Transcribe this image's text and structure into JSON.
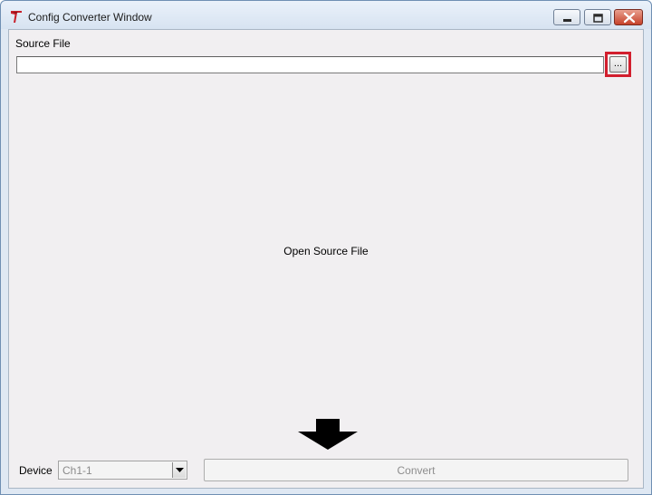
{
  "window": {
    "title": "Config Converter Window",
    "icon": "app-logo-icon",
    "controls": [
      "minimize-icon",
      "maximize-icon",
      "close-icon"
    ]
  },
  "source": {
    "label": "Source File",
    "path_value": "",
    "browse_label": "...",
    "highlight_color": "#d21f2e"
  },
  "main": {
    "message": "Open Source File",
    "arrow_icon": "arrow-down-icon"
  },
  "footer": {
    "device_label": "Device",
    "device_selected": "Ch1-1",
    "convert_label": "Convert"
  },
  "colors": {
    "client_bg": "#f1eff1",
    "frame": "#dfe8f3",
    "close_button": "#c6422a"
  }
}
